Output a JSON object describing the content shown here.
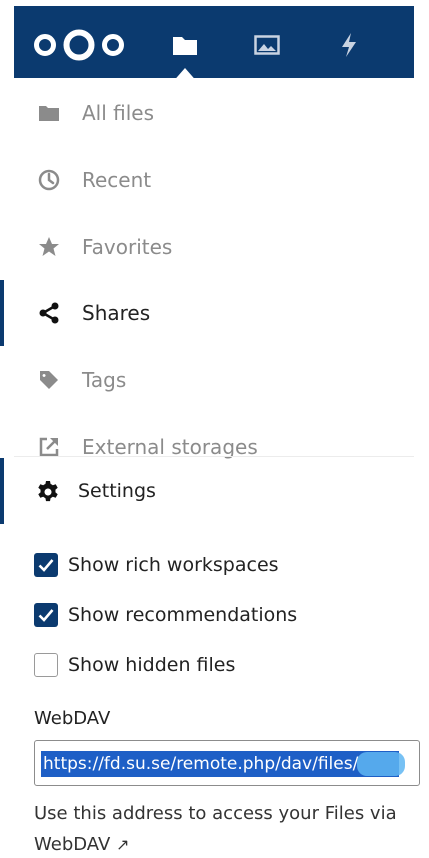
{
  "header": {
    "logo_icon": "nextcloud-logo-icon",
    "apps": [
      {
        "name": "files",
        "icon": "folder-icon",
        "active": true
      },
      {
        "name": "photos",
        "icon": "image-icon",
        "active": false
      },
      {
        "name": "activity",
        "icon": "lightning-icon",
        "active": false
      }
    ],
    "bg_color": "#0b3a6f"
  },
  "nav": {
    "items": [
      {
        "label": "All files",
        "icon": "folder-icon",
        "state": "muted"
      },
      {
        "label": "Recent",
        "icon": "clock-icon",
        "state": "muted"
      },
      {
        "label": "Favorites",
        "icon": "star-icon",
        "state": "muted"
      },
      {
        "label": "Shares",
        "icon": "share-icon",
        "state": "active"
      },
      {
        "label": "Tags",
        "icon": "tag-icon",
        "state": "muted"
      },
      {
        "label": "External storages",
        "icon": "external-link-icon",
        "state": "muted"
      }
    ]
  },
  "settings": {
    "label": "Settings",
    "icon": "gear-icon",
    "options": [
      {
        "label": "Show rich workspaces",
        "checked": true
      },
      {
        "label": "Show recommendations",
        "checked": true
      },
      {
        "label": "Show hidden files",
        "checked": false
      }
    ],
    "webdav": {
      "title": "WebDAV",
      "url": "https://fd.su.se/remote.php/dav/files/",
      "hint": "Use this address to access your Files via WebDAV",
      "hint_arrow": "↗"
    }
  }
}
